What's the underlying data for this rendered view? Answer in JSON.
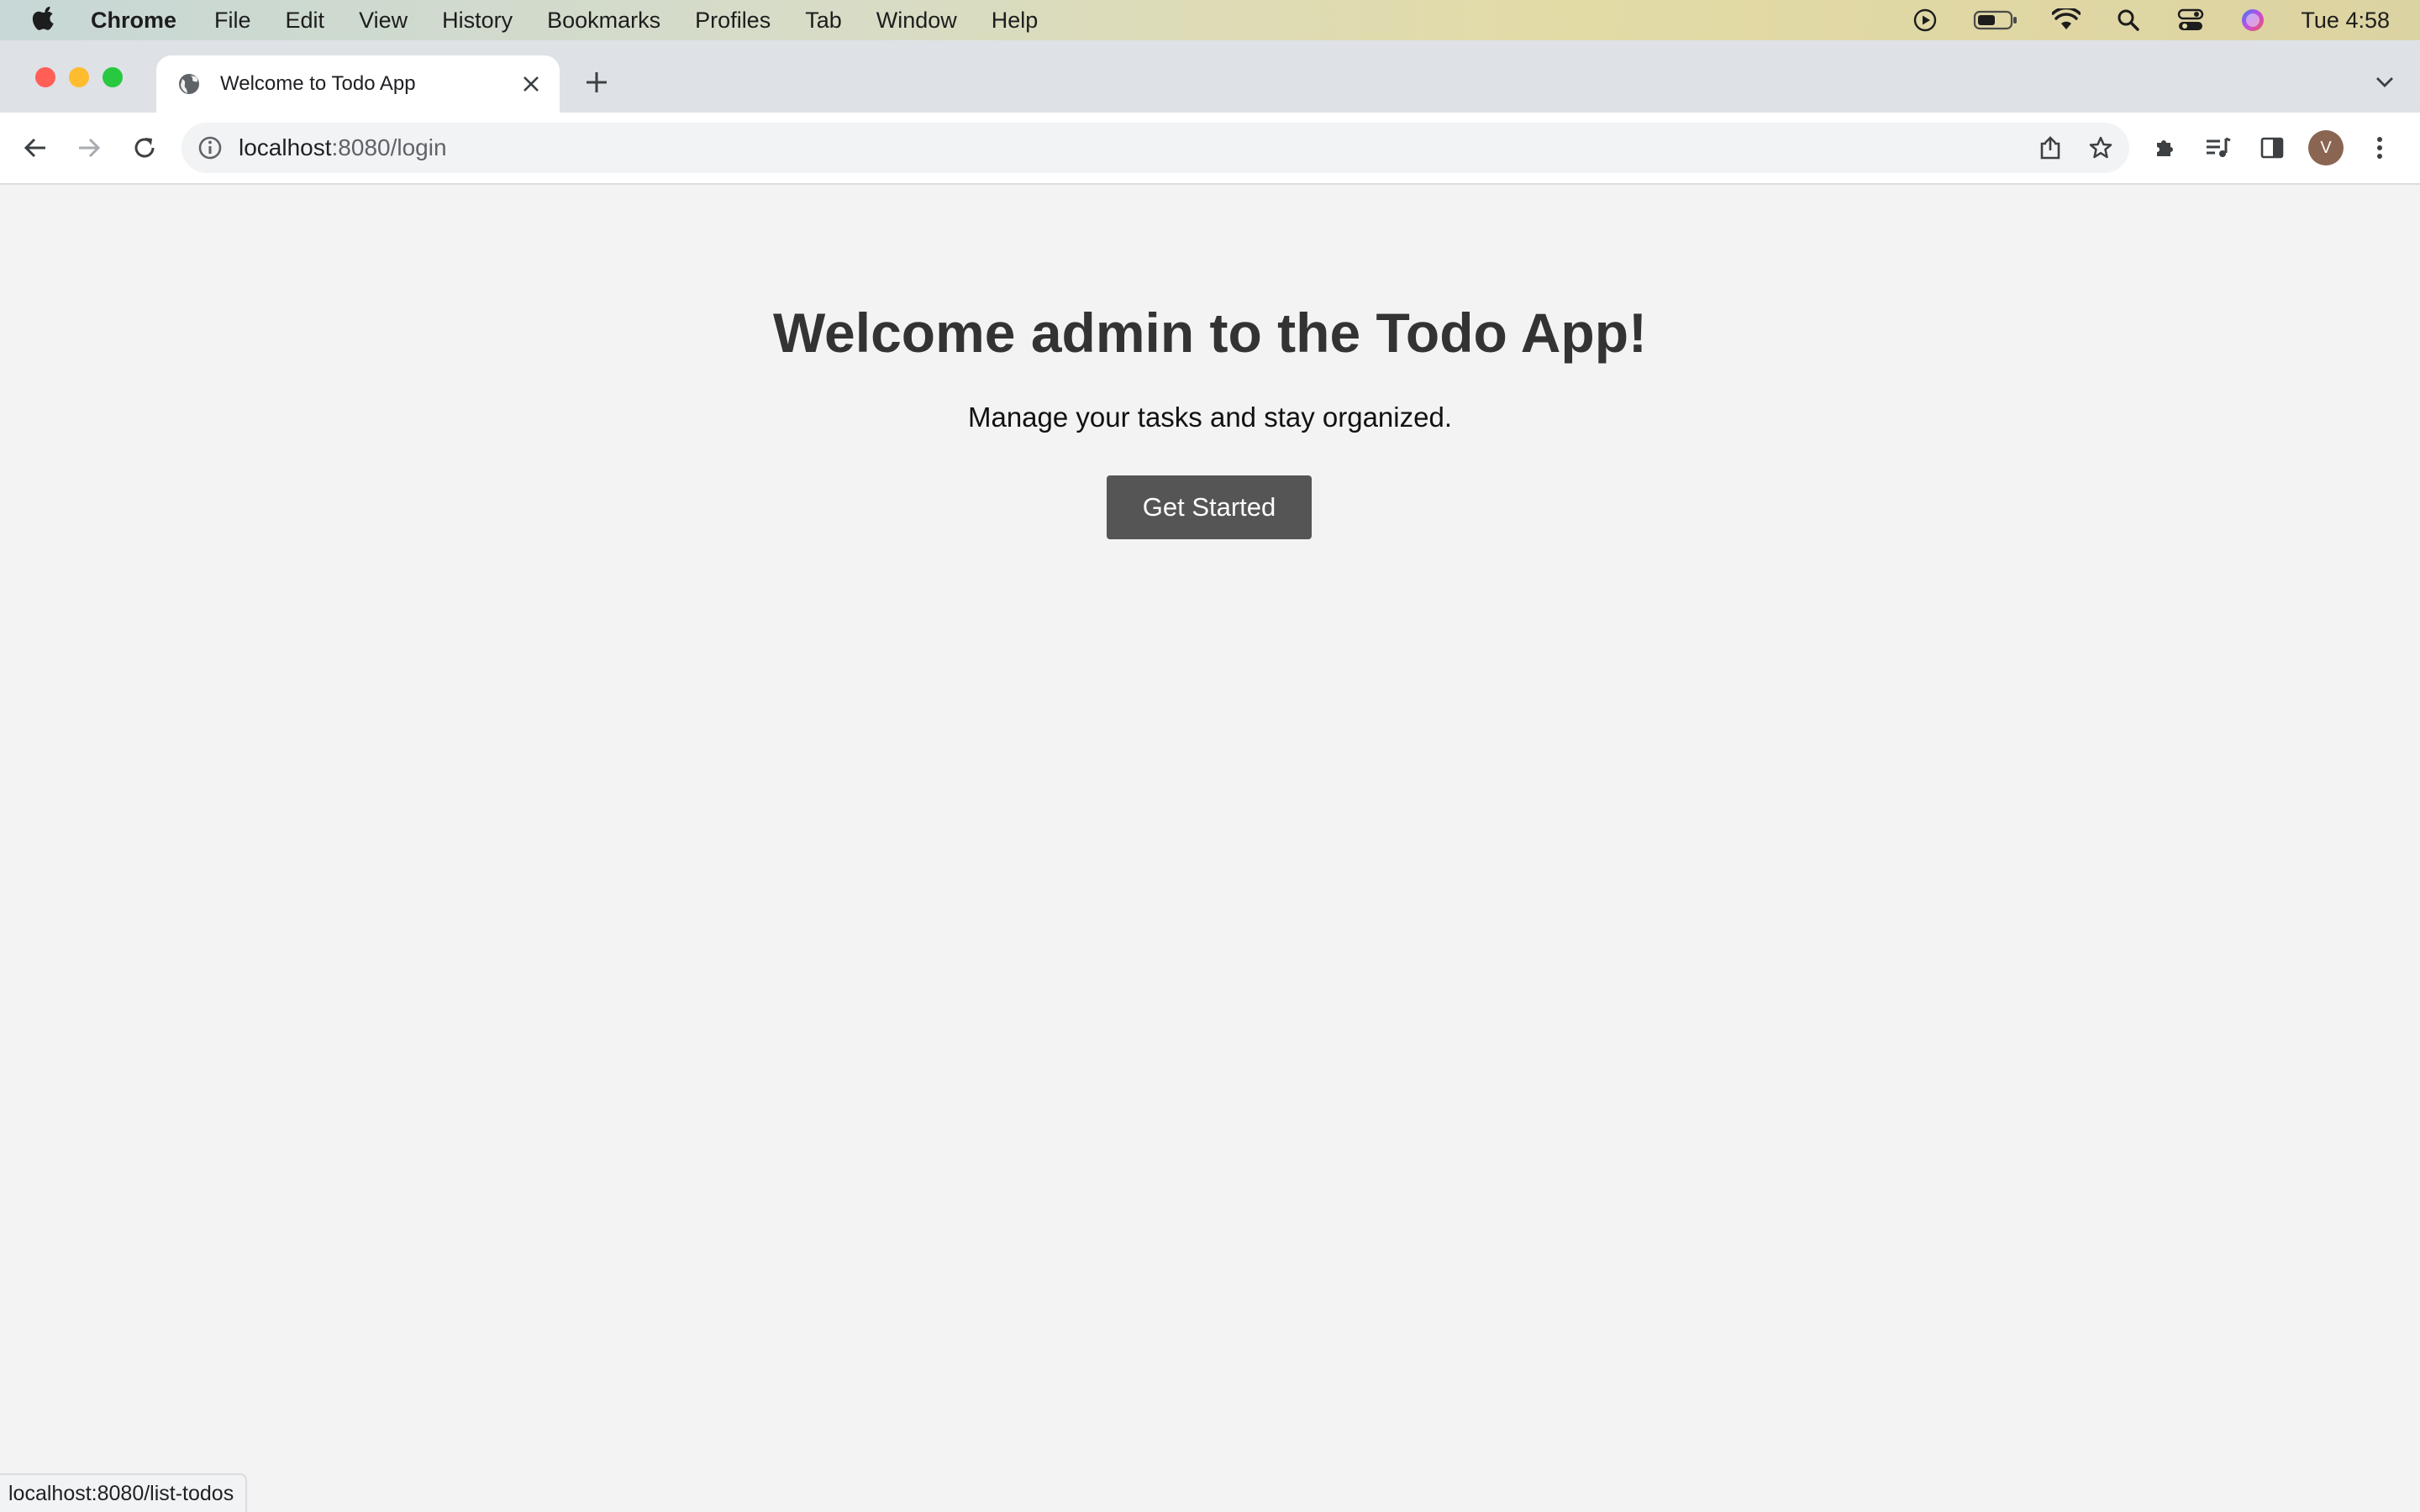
{
  "menubar": {
    "app_name": "Chrome",
    "items": [
      "File",
      "Edit",
      "View",
      "History",
      "Bookmarks",
      "Profiles",
      "Tab",
      "Window",
      "Help"
    ],
    "clock": "Tue 4:58",
    "status_icons": [
      "play-circle-icon",
      "battery-icon",
      "wifi-icon",
      "spotlight-search-icon",
      "control-center-icon",
      "siri-icon"
    ]
  },
  "browser": {
    "tab_title": "Welcome to Todo App",
    "url_host": "localhost",
    "url_path": ":8080/login",
    "avatar_letter": "V",
    "status_url": "localhost:8080/list-todos"
  },
  "page": {
    "title": "Welcome admin to the Todo App!",
    "subtitle": "Manage your tasks and stay organized.",
    "cta_label": "Get Started"
  },
  "colors": {
    "page_bg": "#f3f3f3",
    "heading": "#333333",
    "button_bg": "#555555",
    "button_text": "#ffffff",
    "traffic_close": "#ff5f57",
    "traffic_minimize": "#febc2e",
    "traffic_zoom": "#28c840"
  }
}
